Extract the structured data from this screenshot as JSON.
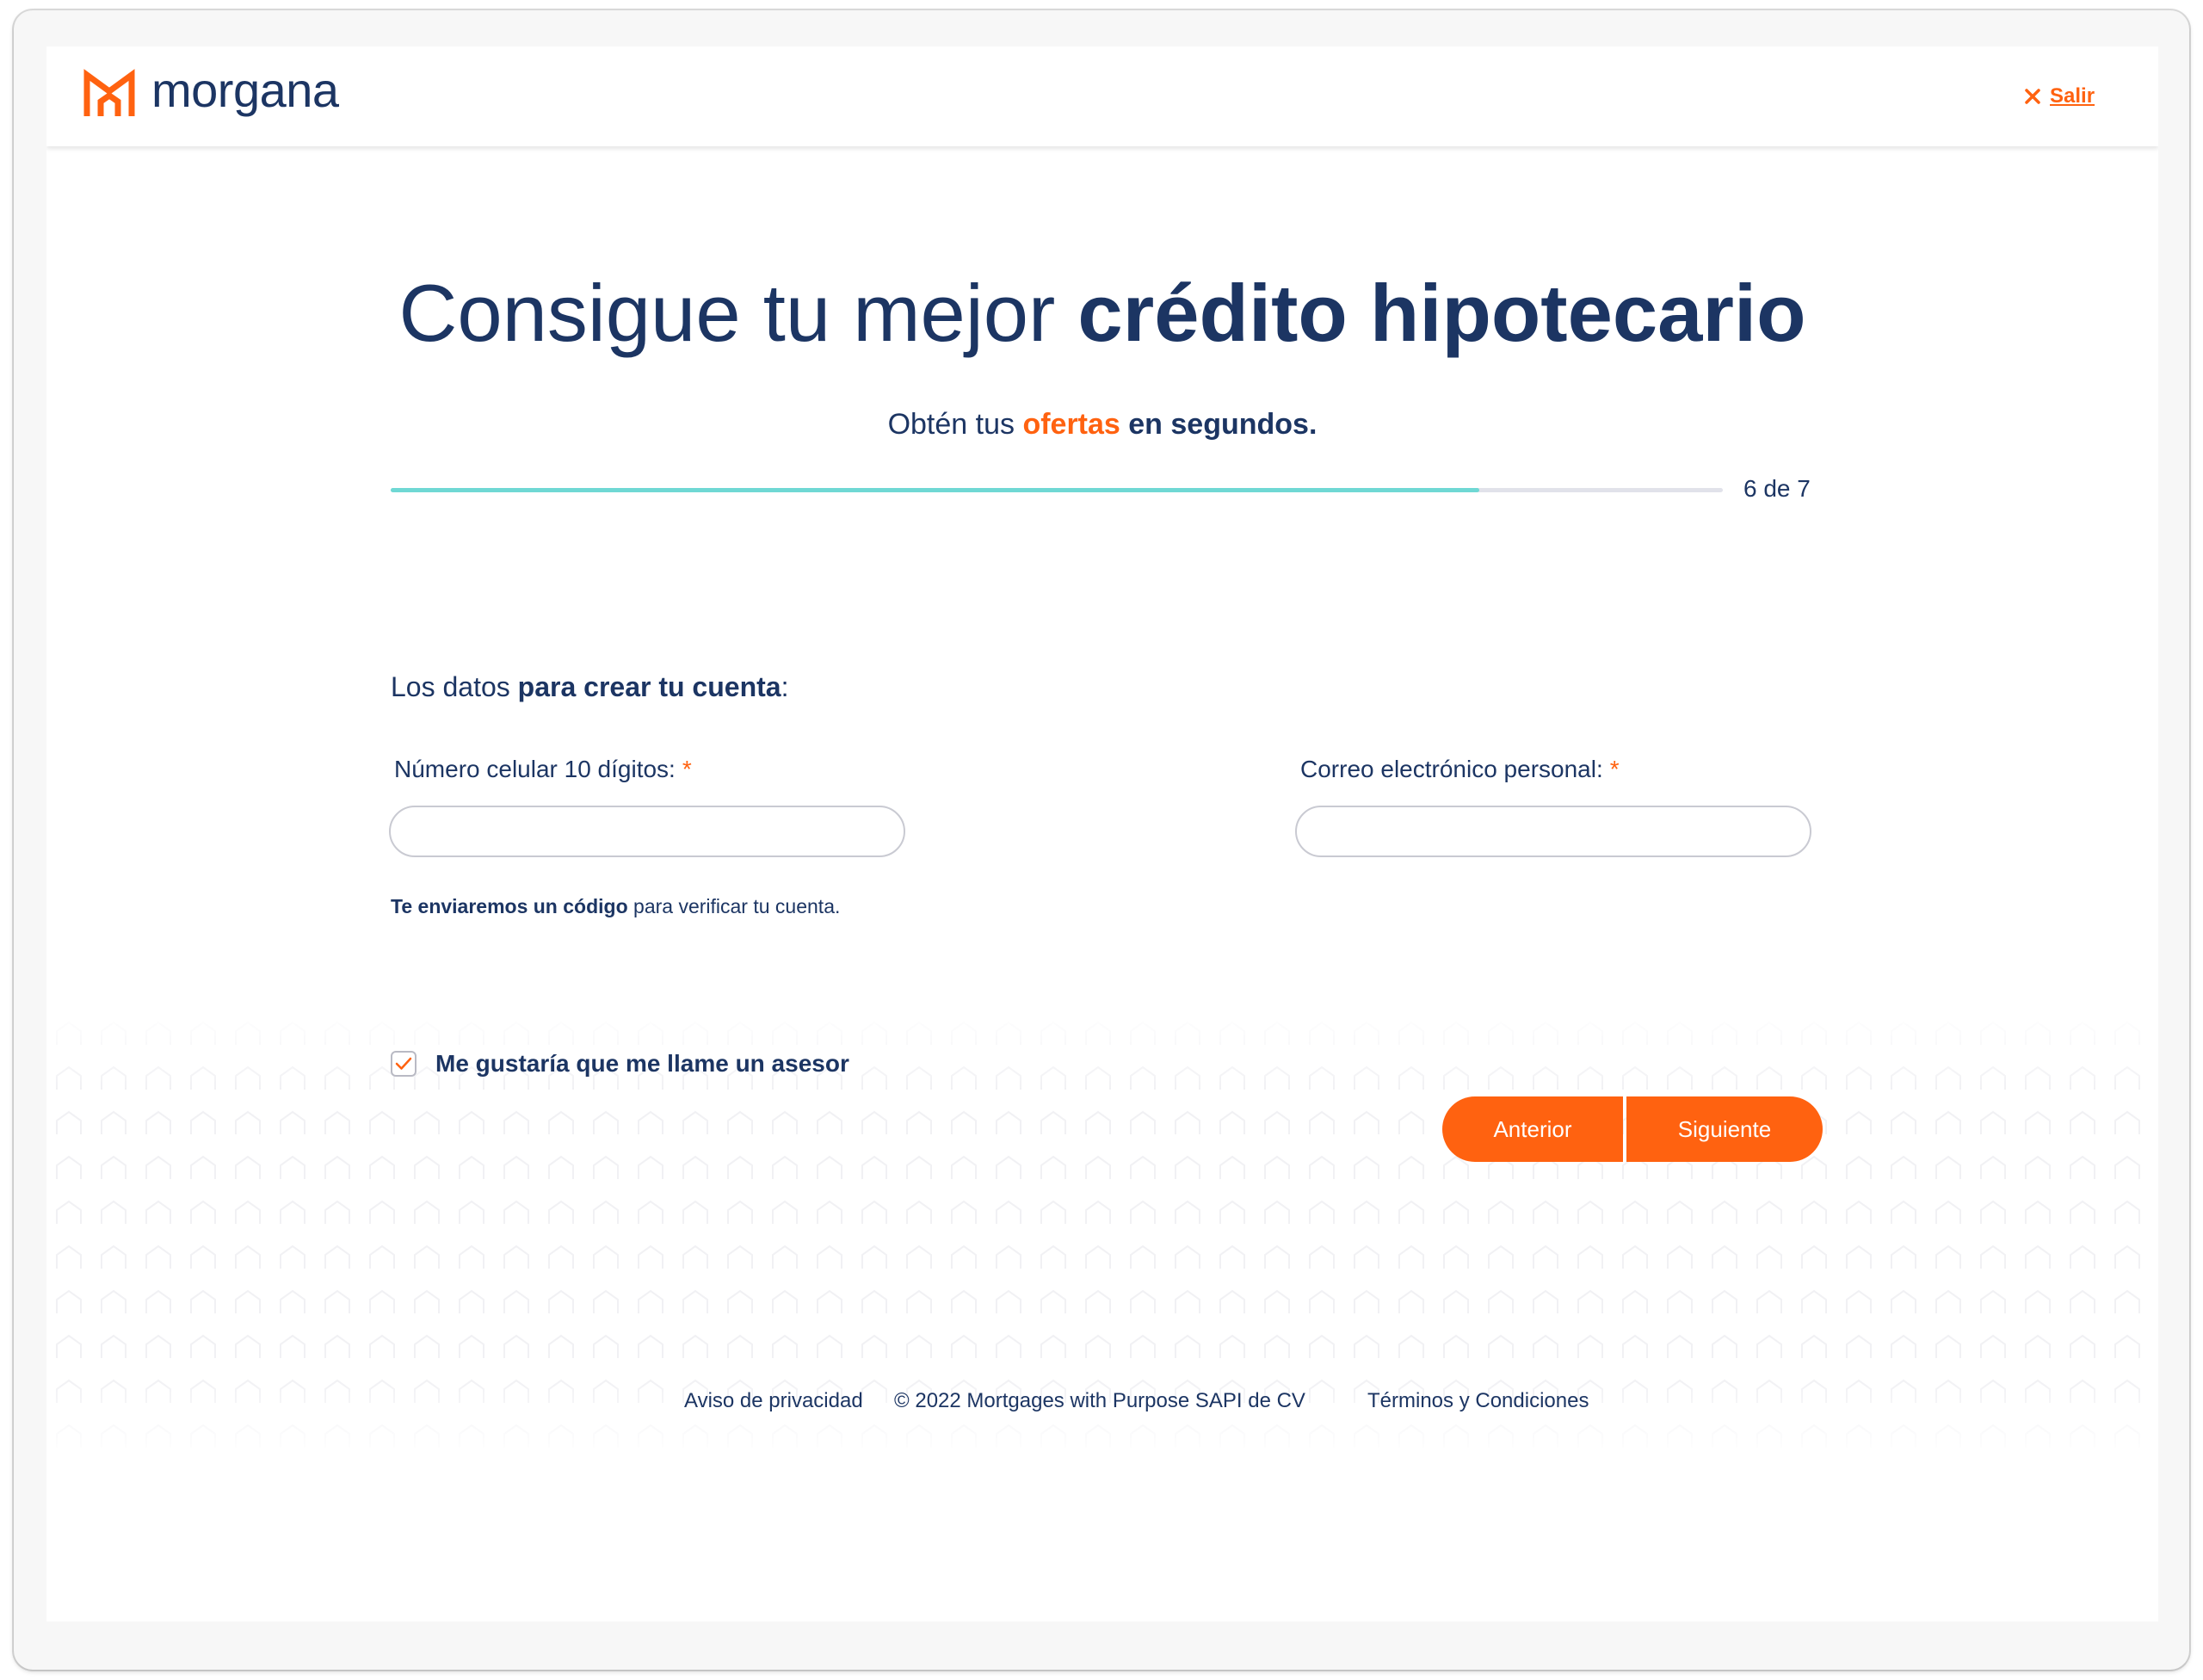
{
  "brand": {
    "name": "morgana",
    "accent_color": "#ff6210",
    "text_color": "#1c3563",
    "progress_color": "#6fd8d4"
  },
  "header": {
    "exit_label": "Salir"
  },
  "hero": {
    "title_regular": "Consigue tu mejor ",
    "title_bold": "crédito hipotecario",
    "subtitle_part1": "Obtén tus ",
    "subtitle_highlight": "ofertas",
    "subtitle_part2": " en segundos."
  },
  "progress": {
    "current": 6,
    "total": 7,
    "label": "6 de 7",
    "fill_fraction": 0.8171
  },
  "form": {
    "heading_regular": "Los datos ",
    "heading_bold": "para crear tu cuenta",
    "heading_colon": ":",
    "phone": {
      "label": "Número celular 10 dígitos:",
      "required_mark": "*",
      "value": ""
    },
    "email": {
      "label": "Correo electrónico personal:",
      "required_mark": "*",
      "value": ""
    },
    "helper_bold": "Te enviaremos un código",
    "helper_regular": " para verificar tu cuenta.",
    "advisor_checkbox": {
      "label": "Me gustaría que me llame un asesor",
      "checked": true
    }
  },
  "actions": {
    "previous_label": "Anterior",
    "next_label": "Siguiente"
  },
  "footer": {
    "privacy": "Aviso de privacidad",
    "copyright": "© 2022 Mortgages with Purpose SAPI de CV",
    "terms": "Términos y Condiciones"
  }
}
